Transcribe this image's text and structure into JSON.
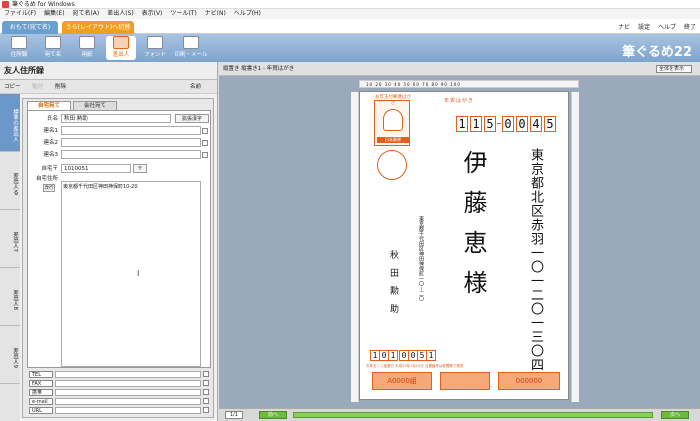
{
  "window": {
    "title": "筆ぐるめ for Windows"
  },
  "menu": [
    "ファイル(F)",
    "編集(E)",
    "宛て名(A)",
    "差出人(S)",
    "表示(V)",
    "ツール(T)",
    "ナビ(N)",
    "ヘルプ(H)"
  ],
  "mode_tabs": {
    "address": "おもて(宛て名)",
    "layout": "うら(レイアウト)へ切替"
  },
  "right_tools": {
    "navi": "ナビ",
    "settings": "設定",
    "help": "ヘルプ",
    "exit": "終了"
  },
  "toolbar": [
    {
      "label": "住所録",
      "icon": "addressbook-icon"
    },
    {
      "label": "宛て名",
      "icon": "address-icon"
    },
    {
      "label": "用紙",
      "icon": "paper-icon"
    },
    {
      "label": "差出人",
      "icon": "sender-icon"
    },
    {
      "label": "フォント",
      "icon": "font-icon"
    },
    {
      "label": "印刷・メール",
      "icon": "print-icon"
    }
  ],
  "brand": "筆ぐるめ22",
  "left": {
    "title": "友人住所録",
    "actions": {
      "copy": "コピー",
      "paste": "貼付",
      "delete": "削除",
      "name_col": "名前"
    },
    "side_tabs": [
      "差出人る",
      "差出人7",
      "差出人8",
      "差出人9",
      "差出人10"
    ],
    "active_side_tab": "標準の差出人",
    "form_tabs": {
      "home": "自宅宛て",
      "work": "会社宛て"
    },
    "fields": {
      "name_label": "氏名",
      "name_value": "秋田 勲助",
      "expand_button": "拡張漢字",
      "joint1_label": "連名1",
      "joint2_label": "連名2",
      "joint3_label": "連名3",
      "zip_label": "自宅〒",
      "zip_value": "1010051",
      "addr_label": "自宅住所",
      "addr_value": "東京都千代田区神田神保町10-20",
      "newline_button": "改行"
    },
    "contacts": [
      {
        "label": "TEL"
      },
      {
        "label": "FAX"
      },
      {
        "label": "携帯"
      },
      {
        "label": "e-mail"
      },
      {
        "label": "URL"
      }
    ]
  },
  "canvas": {
    "breadcrumb": "縦置き 縦書き1 - 年賀はがき",
    "zoom": "全体を表示",
    "ruler": "10  20  30  40  50  60  70  80  90  100",
    "card": {
      "header": "年賀はがき",
      "header_sub": "お年玉付郵便はがき",
      "stamp_caption": "日本郵便",
      "zip_digits": [
        "1",
        "1",
        "5",
        "0",
        "0",
        "4",
        "5"
      ],
      "recipient_address": "東京都北区赤羽一〇一二〇一三〇四",
      "recipient_name": "伊藤恵様",
      "sender_address": "東京都千代田区神田神保町一〇－二〇",
      "sender_name": "秋田勲助",
      "sender_zip": [
        "1",
        "0",
        "1",
        "0",
        "0",
        "5",
        "1"
      ],
      "lottery_note": "お年玉くじ抽選日 平成29年1月15日 当選番号は新聞等で発表",
      "lottery_left": "A0000組",
      "lottery_right": "000000"
    },
    "page": "1/1",
    "prev": "前へ",
    "next": "次へ"
  }
}
